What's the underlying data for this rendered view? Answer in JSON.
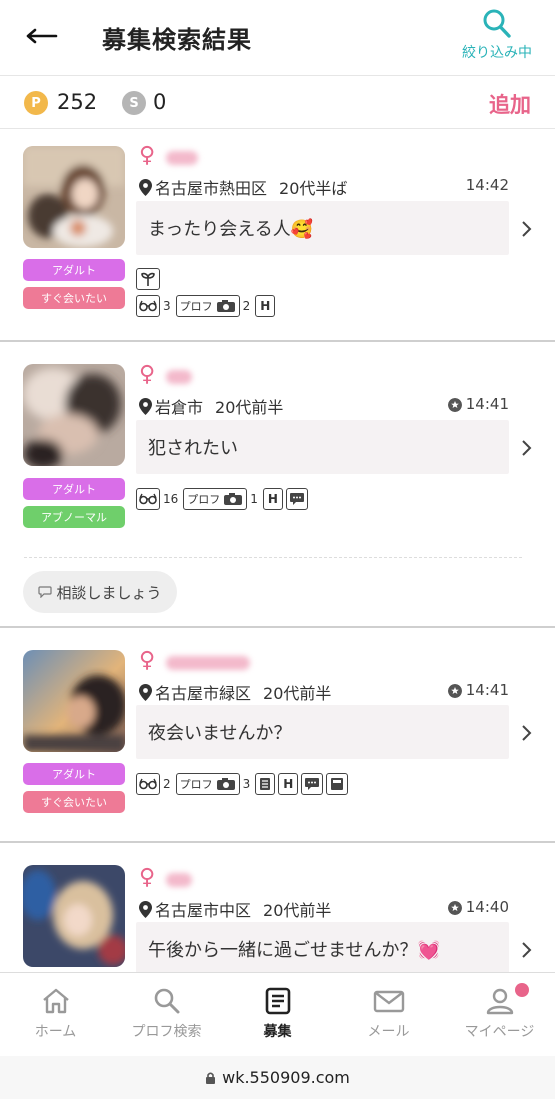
{
  "header": {
    "title": "募集検索結果",
    "filter_label": "絞り込み中"
  },
  "points": {
    "p_label": "P",
    "p_value": "252",
    "s_label": "S",
    "s_value": "0",
    "add_label": "追加"
  },
  "cards": [
    {
      "location": "名古屋市熱田区",
      "age": "20代半ば",
      "time": "14:42",
      "message": "まったり会える人🥰",
      "tags": [
        "アダルト",
        "すぐ会いたい"
      ],
      "icons": {
        "glasses_count": "3",
        "profile_label": "プロフ",
        "photo_count": "2"
      }
    },
    {
      "location": "岩倉市",
      "age": "20代前半",
      "time": "14:41",
      "message": "犯されたい",
      "tags": [
        "アダルト",
        "アブノーマル"
      ],
      "icons": {
        "glasses_count": "16",
        "profile_label": "プロフ",
        "photo_count": "1"
      },
      "consult_label": "相談しましょう"
    },
    {
      "location": "名古屋市緑区",
      "age": "20代前半",
      "time": "14:41",
      "message": "夜会いませんか？",
      "tags": [
        "アダルト",
        "すぐ会いたい"
      ],
      "icons": {
        "glasses_count": "2",
        "profile_label": "プロフ",
        "photo_count": "3"
      }
    },
    {
      "location": "名古屋市中区",
      "age": "20代前半",
      "time": "14:40",
      "message": "午後から一緒に過ごせませんか？💓",
      "tags": [],
      "icons": {}
    }
  ],
  "nav": [
    {
      "label": "ホーム",
      "icon": "home-icon"
    },
    {
      "label": "プロフ検索",
      "icon": "search-icon"
    },
    {
      "label": "募集",
      "icon": "list-icon"
    },
    {
      "label": "メール",
      "icon": "mail-icon"
    },
    {
      "label": "マイページ",
      "icon": "person-icon"
    }
  ],
  "url": "wk.550909.com",
  "colors": {
    "accent_pink": "#e8648a",
    "teal": "#2ab3b8",
    "tag_purple": "#d96ee8",
    "tag_pink": "#ee7a96",
    "tag_green": "#6fcf6b"
  }
}
